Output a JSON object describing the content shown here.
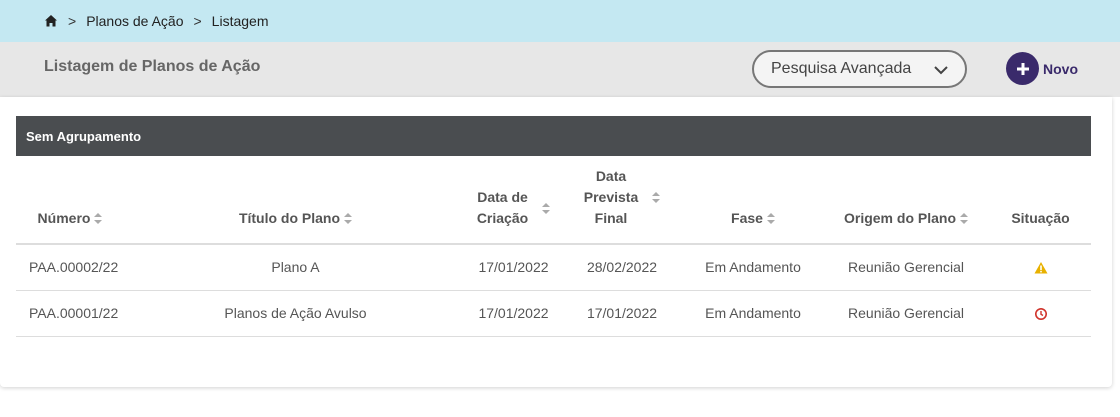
{
  "breadcrumb": {
    "home_icon": "home-icon",
    "items": [
      "Planos de Ação",
      "Listagem"
    ],
    "separator": ">"
  },
  "header": {
    "title": "Listagem de Planos de Ação",
    "advanced_search_label": "Pesquisa Avançada",
    "new_button_label": "Novo"
  },
  "table": {
    "group_label": "Sem Agrupamento",
    "columns": {
      "numero": "Número",
      "titulo": "Título do Plano",
      "criacao_line1": "Data de",
      "criacao_line2": "Criação",
      "prevista_line1": "Data",
      "prevista_line2": "Prevista",
      "prevista_line3": "Final",
      "fase": "Fase",
      "origem": "Origem do Plano",
      "situacao": "Situação"
    },
    "rows": [
      {
        "numero": "PAA.00002/22",
        "titulo": "Plano A",
        "criacao": "17/01/2022",
        "prevista": "28/02/2022",
        "fase": "Em Andamento",
        "origem": "Reunião Gerencial",
        "situacao_icon": "warning-icon",
        "situacao_color": "#e8b100"
      },
      {
        "numero": "PAA.00001/22",
        "titulo": "Planos de Ação Avulso",
        "criacao": "17/01/2022",
        "prevista": "17/01/2022",
        "fase": "Em Andamento",
        "origem": "Reunião Gerencial",
        "situacao_icon": "overdue-clock-icon",
        "situacao_color": "#d0342c"
      }
    ]
  },
  "colors": {
    "breadcrumb_bg": "#c4e8f2",
    "header_bg": "#e7e7e7",
    "group_bar_bg": "#4a4d50",
    "accent": "#3a2a6b"
  }
}
